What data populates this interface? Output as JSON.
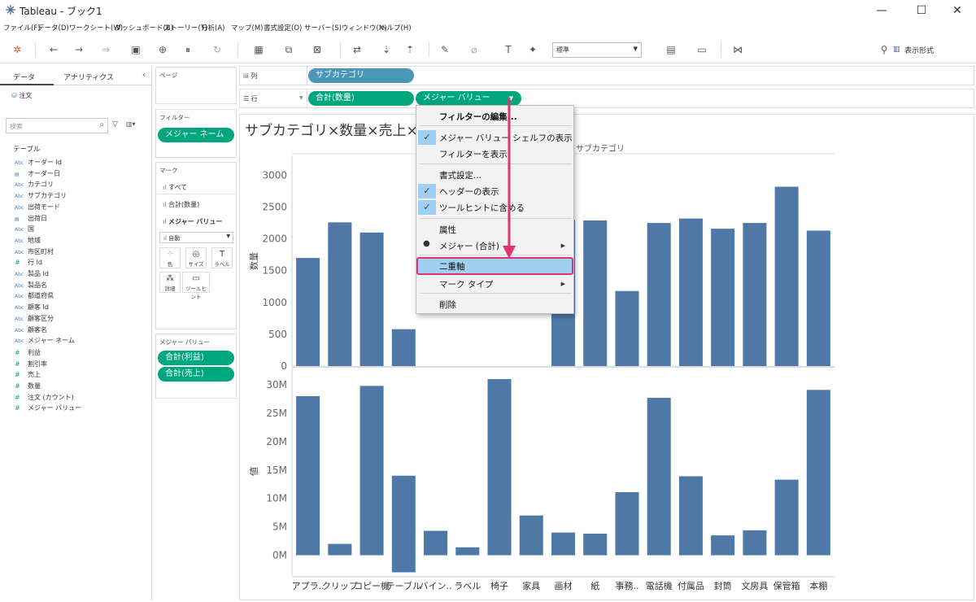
{
  "window": {
    "title": "Tableau - ブック1",
    "minimize_glyph": "—",
    "maximize_glyph": "☐",
    "close_glyph": "✕"
  },
  "menubar": [
    "ファイル(F)",
    "データ(D)",
    "ワークシート(W)",
    "ダッシュボード(B)",
    "ストーリー(T)",
    "分析(A)",
    "マップ(M)",
    "書式設定(O)",
    "サーバー(S)",
    "ウィンドウ(N)",
    "ヘルプ(H)"
  ],
  "toolbar": {
    "format_select_value": "標準",
    "show_format_label": "表示形式"
  },
  "left_pane": {
    "tab_data": "データ",
    "tab_analytics": "アナリティクス",
    "datasource": "注文",
    "search_placeholder": "検索",
    "table_heading": "テーブル",
    "dimensions": [
      {
        "type": "Abc",
        "name": "オーダー Id"
      },
      {
        "type": "date",
        "name": "オーダー日"
      },
      {
        "type": "Abc",
        "name": "カテゴリ"
      },
      {
        "type": "Abc",
        "name": "サブカテゴリ"
      },
      {
        "type": "Abc",
        "name": "出荷モード"
      },
      {
        "type": "date",
        "name": "出荷日"
      },
      {
        "type": "Abc",
        "name": "国"
      },
      {
        "type": "Abc",
        "name": "地域"
      },
      {
        "type": "Abc",
        "name": "市区町村"
      },
      {
        "type": "#",
        "name": "行 Id"
      },
      {
        "type": "Abc",
        "name": "製品 Id"
      },
      {
        "type": "Abc",
        "name": "製品名"
      },
      {
        "type": "Abc",
        "name": "都道府県"
      },
      {
        "type": "Abc",
        "name": "顧客 Id"
      },
      {
        "type": "Abc",
        "name": "顧客区分"
      },
      {
        "type": "Abc",
        "name": "顧客名"
      },
      {
        "type": "Abc",
        "name": "メジャー ネーム"
      }
    ],
    "measures": [
      {
        "type": "#",
        "name": "利益"
      },
      {
        "type": "#",
        "name": "割引率"
      },
      {
        "type": "#",
        "name": "売上"
      },
      {
        "type": "#",
        "name": "数量"
      },
      {
        "type": "#",
        "name": "注文 (カウント)"
      },
      {
        "type": "#",
        "name": "メジャー バリュー"
      }
    ]
  },
  "pages_panel": {
    "label": "ページ"
  },
  "filters_panel": {
    "label": "フィルター",
    "pill": "メジャー ネーム"
  },
  "marks_panel": {
    "label": "マーク",
    "rows": [
      "すべて",
      "合計(数量)",
      "メジャー バリュー"
    ],
    "mark_type": "自動",
    "buttons": [
      "色",
      "サイズ",
      "ラベル",
      "詳細",
      "ツールヒント"
    ]
  },
  "measure_values_panel": {
    "label": "メジャー バリュー",
    "pills": [
      "合計(利益)",
      "合計(売上)"
    ]
  },
  "shelves": {
    "columns_label": "列",
    "columns_pill": "サブカテゴリ",
    "rows_label": "行",
    "rows_pills": [
      "合計(数量)",
      "メジャー バリュー"
    ]
  },
  "view": {
    "title": "サブカテゴリ×数量×売上×利",
    "header": "サブカテゴリ"
  },
  "context_menu": {
    "items": [
      {
        "label": "フィルターの編集...",
        "bold": true
      },
      {
        "label": "メジャー バリュー シェルフの表示",
        "checked": true
      },
      {
        "label": "フィルターを表示"
      },
      {
        "label": "書式設定..."
      },
      {
        "label": "ヘッダーの表示",
        "checked": true
      },
      {
        "label": "ツールヒントに含める",
        "checked": true
      },
      {
        "label": "属性"
      },
      {
        "label": "メジャー (合計)",
        "bullet": true,
        "submenu": true
      },
      {
        "label": "二重軸",
        "highlighted": true
      },
      {
        "label": "マーク タイプ",
        "submenu": true
      },
      {
        "label": "削除"
      }
    ]
  },
  "chart_data": {
    "type": "bar",
    "bar_color": "#4e79a7",
    "categories": [
      "アプラ..",
      "クリップ",
      "コピー機",
      "テーブル",
      "バイン..",
      "ラベル",
      "椅子",
      "家具",
      "画材",
      "紙",
      "事務..",
      "電話機",
      "付属品",
      "封筒",
      "文房具",
      "保管箱",
      "本棚"
    ],
    "panes": [
      {
        "ylabel": "数量",
        "ylim": [
          0,
          3300
        ],
        "ticks": [
          0,
          500,
          1000,
          1500,
          2000,
          2500,
          3000
        ],
        "tick_labels": [
          "0",
          "500",
          "1000",
          "1500",
          "2000",
          "2500",
          "3000"
        ],
        "values": [
          1700,
          2260,
          2100,
          580,
          null,
          null,
          null,
          null,
          2300,
          2290,
          1180,
          2250,
          2320,
          2160,
          2250,
          2820,
          2130
        ]
      },
      {
        "ylabel": "値",
        "ylim": [
          -3500000,
          33000000
        ],
        "ticks": [
          0,
          5000000,
          10000000,
          15000000,
          20000000,
          25000000,
          30000000
        ],
        "tick_labels": [
          "0M",
          "5M",
          "10M",
          "15M",
          "20M",
          "25M",
          "30M"
        ],
        "values": [
          28000000,
          2000000,
          29800000,
          14000000,
          4300000,
          1400000,
          31000000,
          7000000,
          4000000,
          3800000,
          11100000,
          27700000,
          13900000,
          3500000,
          4400000,
          13300000,
          29100000
        ],
        "negatives": [
          0,
          0,
          0,
          -3000000,
          0,
          0,
          0,
          0,
          0,
          0,
          0,
          0,
          0,
          0,
          0,
          0,
          0
        ]
      }
    ]
  }
}
